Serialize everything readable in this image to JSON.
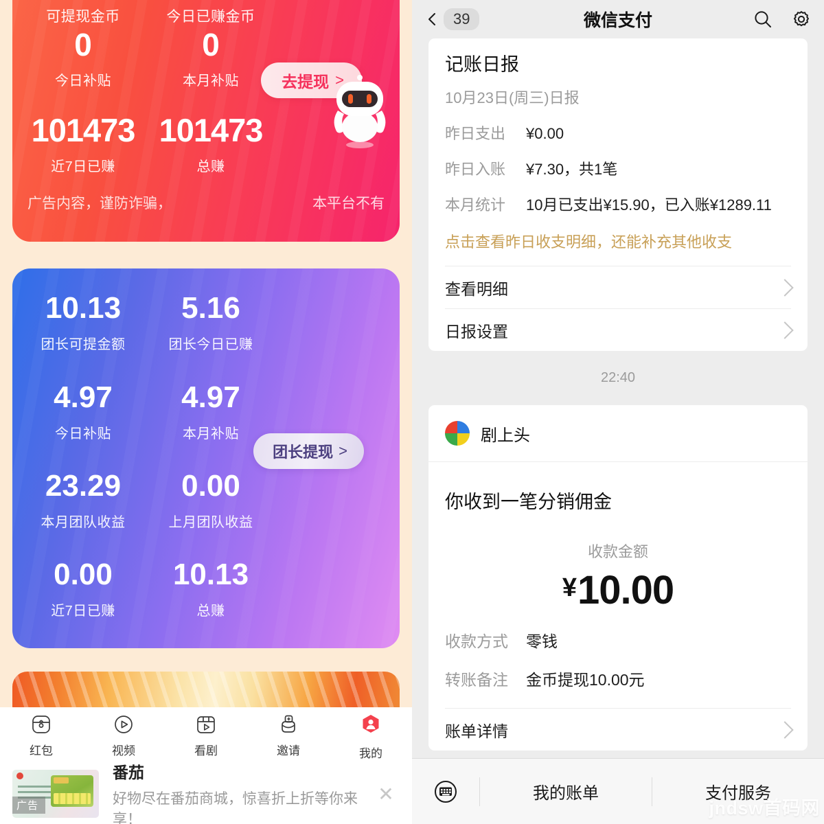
{
  "earnings_app": {
    "gold_card": {
      "header_labels": [
        "可提现金币",
        "今日已赚金币"
      ],
      "rows": [
        {
          "values": [
            "0",
            "0"
          ],
          "labels": [
            "今日补贴",
            "本月补贴"
          ]
        },
        {
          "values": [
            "101473",
            "101473"
          ],
          "labels": [
            "近7日已赚",
            "总赚"
          ]
        }
      ],
      "withdraw_button": "去提现",
      "chevron": ">",
      "marquee_left": "广告内容，谨防诈骗，",
      "marquee_right": "本平台不有"
    },
    "leader_card": {
      "rows": [
        {
          "values": [
            "10.13",
            "5.16"
          ],
          "labels": [
            "团长可提金额",
            "团长今日已赚"
          ]
        },
        {
          "values": [
            "4.97",
            "4.97"
          ],
          "labels": [
            "今日补贴",
            "本月补贴"
          ]
        },
        {
          "values": [
            "23.29",
            "0.00"
          ],
          "labels": [
            "本月团队收益",
            "上月团队收益"
          ]
        },
        {
          "values": [
            "0.00",
            "10.13"
          ],
          "labels": [
            "近7日已赚",
            "总赚"
          ]
        }
      ],
      "withdraw_button": "团长提现",
      "chevron": ">"
    },
    "tabbar": [
      {
        "label": "红包",
        "icon": "redpacket-icon",
        "active": false
      },
      {
        "label": "视频",
        "icon": "play-circle-icon",
        "active": false
      },
      {
        "label": "看剧",
        "icon": "drama-icon",
        "active": false
      },
      {
        "label": "邀请",
        "icon": "invite-icon",
        "active": false
      },
      {
        "label": "我的",
        "icon": "profile-icon",
        "active": true
      }
    ],
    "ad": {
      "tag": "广告",
      "title": "番茄",
      "desc": "好物尽在番茄商城，惊喜折上折等你来享！",
      "close": "✕"
    },
    "colors": {
      "page_bg": "#fdebd6",
      "gold_card_start": "#fb6647",
      "gold_card_end": "#f6246c",
      "leader_card_start": "#2f6fe8",
      "leader_card_end": "#e08cf2",
      "active_tab": "#f4414d"
    }
  },
  "wechat_pay": {
    "nav": {
      "back_badge": "39",
      "title": "微信支付",
      "search_icon": "search-icon",
      "settings_icon": "gear-icon"
    },
    "daily_report": {
      "title": "记账日报",
      "subtitle": "10月23日(周三)日报",
      "fields": [
        {
          "key": "昨日支出",
          "value": "¥0.00"
        },
        {
          "key": "昨日入账",
          "value": "¥7.30，共1笔"
        },
        {
          "key": "本月统计",
          "value": "10月已支出¥15.90，已入账¥1289.11"
        }
      ],
      "hint": "点击查看昨日收支明细，还能补充其他收支",
      "rows": [
        "查看明细",
        "日报设置"
      ]
    },
    "timestamp": "22:40",
    "commission_card": {
      "brand": "剧上头",
      "brand_logo_colors": [
        "#e8402f",
        "#2f7de1",
        "#3aa94a",
        "#f2cf1c"
      ],
      "message_title": "你收到一笔分销佣金",
      "amount_label": "收款金额",
      "currency": "¥",
      "amount": "10.00",
      "fields": [
        {
          "key": "收款方式",
          "value": "零钱"
        },
        {
          "key": "转账备注",
          "value": "金币提现10.00元"
        }
      ],
      "detail_row": "账单详情"
    },
    "bottom_bar": {
      "keyboard_icon": "keyboard-icon",
      "items": [
        "我的账单",
        "支付服务"
      ]
    },
    "watermark": "jndsw首码网"
  }
}
